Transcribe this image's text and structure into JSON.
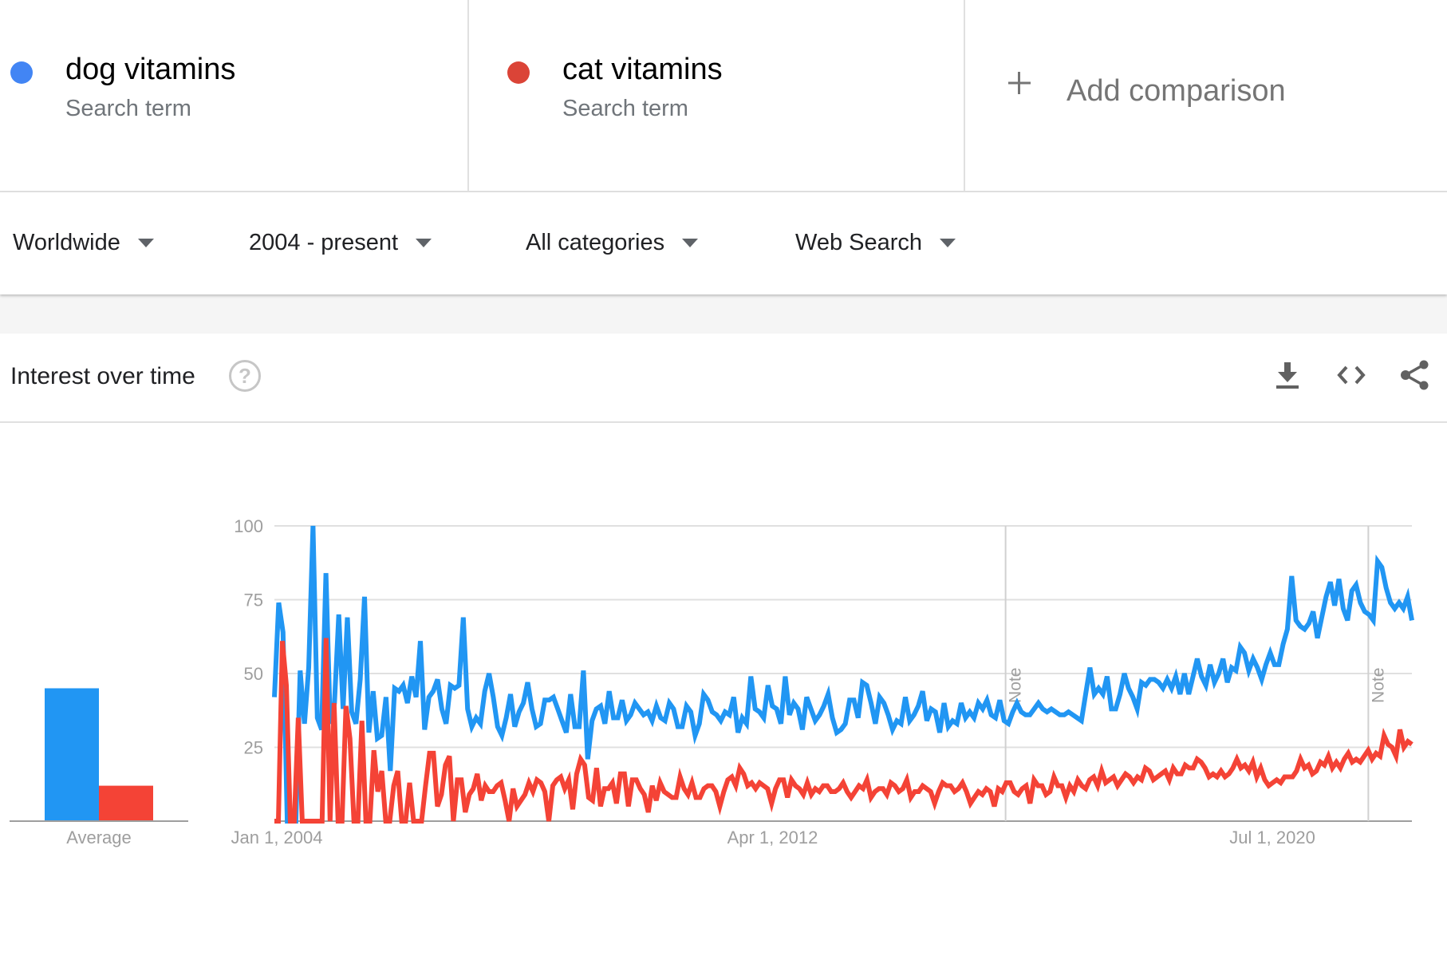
{
  "terms": [
    {
      "name": "dog vitamins",
      "type": "Search term",
      "color": "#4285f4"
    },
    {
      "name": "cat vitamins",
      "type": "Search term",
      "color": "#db4437"
    }
  ],
  "add_comparison": {
    "label": "Add comparison",
    "icon": "plus-icon"
  },
  "filters": [
    {
      "label": "Worldwide"
    },
    {
      "label": "2004 - present"
    },
    {
      "label": "All categories"
    },
    {
      "label": "Web Search"
    }
  ],
  "widget": {
    "title": "Interest over time",
    "help_icon": "?",
    "actions": [
      {
        "name": "download",
        "icon": "download-icon"
      },
      {
        "name": "embed",
        "icon": "code-icon"
      },
      {
        "name": "share",
        "icon": "share-icon"
      }
    ]
  },
  "chart_data": {
    "type": "line",
    "title": "Interest over time",
    "xlabel": "",
    "ylabel": "",
    "ylim": [
      0,
      100
    ],
    "yticks": [
      25,
      50,
      75,
      100
    ],
    "xticks": [
      "Jan 1, 2004",
      "Apr 1, 2012",
      "Jul 1, 2020"
    ],
    "x_range": [
      "Jan 2004",
      "present"
    ],
    "grid": true,
    "annotations": [
      {
        "label": "Note",
        "position_fraction": 0.6428
      },
      {
        "label": "Note",
        "position_fraction": 0.9617
      }
    ],
    "average": {
      "label": "Average",
      "values": [
        {
          "name": "dog vitamins",
          "value": 45
        },
        {
          "name": "cat vitamins",
          "value": 12
        }
      ]
    },
    "series": [
      {
        "name": "dog vitamins",
        "color": "#2196f3",
        "values": [
          42,
          74,
          64,
          0,
          0,
          0,
          51,
          33,
          52,
          100,
          35,
          31,
          84,
          33,
          40,
          70,
          38,
          69,
          37,
          33,
          48,
          76,
          30,
          44,
          28,
          29,
          42,
          17,
          45,
          44,
          46,
          40,
          49,
          42,
          61,
          31,
          42,
          44,
          48,
          38,
          33,
          46,
          45,
          46,
          69,
          38,
          32,
          35,
          33,
          44,
          50,
          42,
          32,
          29,
          35,
          43,
          32,
          37,
          40,
          47,
          38,
          32,
          33,
          41,
          41,
          42,
          38,
          34,
          30,
          43,
          32,
          32,
          51,
          21,
          34,
          38,
          39,
          33,
          44,
          35,
          35,
          41,
          34,
          36,
          40,
          38,
          36,
          37,
          34,
          39,
          35,
          34,
          40,
          38,
          32,
          32,
          39,
          37,
          29,
          33,
          43,
          41,
          37,
          36,
          34,
          37,
          36,
          42,
          30,
          35,
          33,
          49,
          38,
          37,
          35,
          46,
          39,
          38,
          33,
          49,
          36,
          40,
          38,
          31,
          42,
          38,
          34,
          36,
          39,
          43,
          35,
          30,
          31,
          33,
          41,
          41,
          35,
          47,
          46,
          40,
          33,
          42,
          40,
          36,
          31,
          34,
          33,
          42,
          34,
          36,
          39,
          44,
          34,
          38,
          37,
          30,
          40,
          32,
          34,
          33,
          40,
          35,
          37,
          35,
          40,
          38,
          41,
          36,
          35,
          41,
          34,
          33,
          37,
          40,
          37,
          36,
          36,
          38,
          40,
          38,
          37,
          38,
          37,
          36,
          36,
          37,
          36,
          35,
          34,
          43,
          52,
          43,
          45,
          43,
          49,
          38,
          38,
          43,
          50,
          45,
          42,
          38,
          47,
          46,
          48,
          48,
          47,
          45,
          48,
          45,
          49,
          43,
          50,
          43,
          49,
          55,
          49,
          46,
          53,
          47,
          50,
          55,
          47,
          52,
          51,
          59,
          57,
          51,
          55,
          52,
          48,
          53,
          57,
          53,
          53,
          60,
          65,
          83,
          68,
          66,
          65,
          67,
          71,
          62,
          69,
          76,
          81,
          73,
          82,
          72,
          68,
          78,
          80,
          74,
          71,
          70,
          68,
          88,
          86,
          79,
          74,
          72,
          74,
          72,
          76,
          68
        ]
      },
      {
        "name": "cat vitamins",
        "color": "#f44336",
        "values": [
          0,
          0,
          61,
          46,
          0,
          0,
          35,
          0,
          0,
          0,
          0,
          0,
          0,
          62,
          0,
          40,
          0,
          0,
          39,
          28,
          0,
          0,
          34,
          0,
          0,
          24,
          10,
          17,
          0,
          0,
          12,
          17,
          0,
          0,
          13,
          0,
          0,
          0,
          12,
          23,
          23,
          5,
          9,
          19,
          22,
          0,
          14,
          14,
          3,
          9,
          11,
          16,
          7,
          12,
          10,
          10,
          12,
          13,
          7,
          0,
          11,
          5,
          7,
          9,
          13,
          10,
          14,
          13,
          10,
          0,
          12,
          14,
          15,
          11,
          14,
          4,
          16,
          21,
          19,
          8,
          7,
          18,
          5,
          11,
          11,
          13,
          6,
          16,
          16,
          5,
          14,
          14,
          11,
          9,
          3,
          12,
          7,
          13,
          10,
          9,
          8,
          8,
          15,
          11,
          9,
          13,
          8,
          8,
          11,
          12,
          12,
          10,
          5,
          10,
          14,
          15,
          12,
          18,
          16,
          12,
          13,
          11,
          13,
          12,
          11,
          6,
          11,
          14,
          14,
          8,
          14,
          12,
          11,
          9,
          13,
          9,
          11,
          10,
          12,
          12,
          10,
          10,
          11,
          13,
          10,
          8,
          10,
          12,
          11,
          14,
          8,
          10,
          11,
          11,
          9,
          13,
          12,
          10,
          11,
          14,
          8,
          10,
          10,
          12,
          11,
          10,
          6,
          10,
          13,
          12,
          12,
          10,
          11,
          13,
          10,
          6,
          8,
          10,
          9,
          11,
          10,
          5,
          11,
          10,
          13,
          13,
          10,
          9,
          11,
          12,
          6,
          14,
          12,
          12,
          9,
          10,
          15,
          12,
          12,
          8,
          12,
          10,
          14,
          12,
          11,
          14,
          15,
          12,
          17,
          13,
          14,
          15,
          12,
          14,
          16,
          15,
          13,
          15,
          14,
          18,
          17,
          14,
          15,
          16,
          17,
          14,
          18,
          16,
          16,
          19,
          18,
          18,
          21,
          20,
          18,
          15,
          16,
          15,
          17,
          15,
          16,
          18,
          21,
          18,
          19,
          17,
          20,
          15,
          18,
          14,
          12,
          13,
          14,
          13,
          15,
          15,
          15,
          17,
          21,
          18,
          19,
          16,
          17,
          20,
          19,
          22,
          18,
          20,
          18,
          21,
          23,
          20,
          21,
          20,
          22,
          24,
          21,
          23,
          22,
          29,
          26,
          25,
          22,
          31,
          25,
          27,
          26
        ]
      }
    ]
  }
}
